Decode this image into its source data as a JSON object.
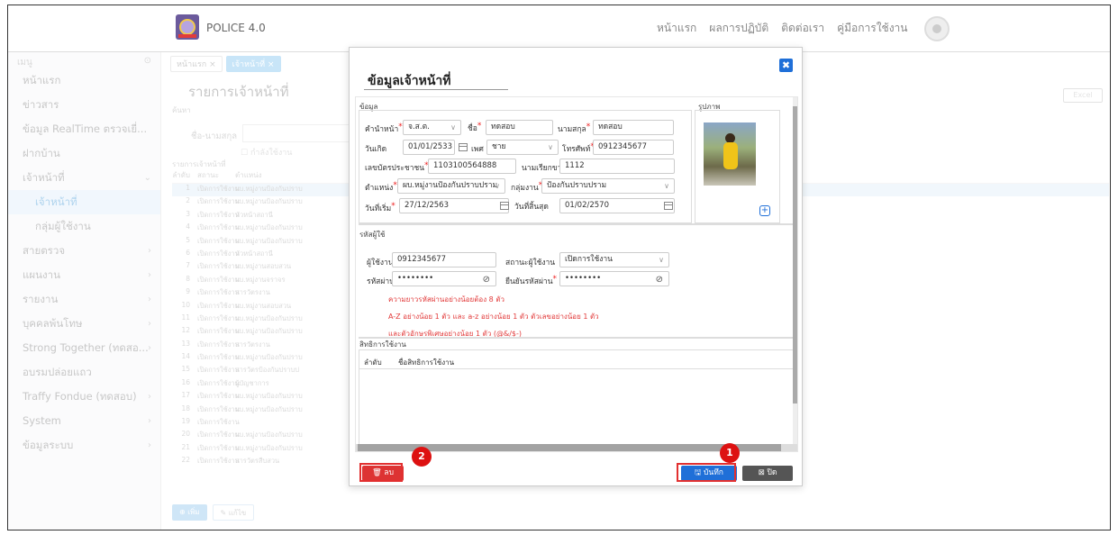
{
  "app": {
    "title": "POLICE 4.0",
    "logo_text": "POLICE 4.0"
  },
  "topnav": [
    "หน้าแรก",
    "ผลการปฏิบัติ",
    "ติดต่อเรา",
    "คู่มือการใช้งาน"
  ],
  "sidebar": {
    "header": "เมนู",
    "items": [
      {
        "label": "หน้าแรก",
        "arrow": ""
      },
      {
        "label": "ข่าวสาร",
        "arrow": ""
      },
      {
        "label": "ข้อมูล RealTime ตรวจเยี่...",
        "arrow": ""
      },
      {
        "label": "ฝากบ้าน",
        "arrow": ""
      },
      {
        "label": "เจ้าหน้าที่",
        "arrow": "⌄"
      },
      {
        "label": "เจ้าหน้าที่",
        "arrow": "",
        "sub": true,
        "active": true
      },
      {
        "label": "กลุ่มผู้ใช้งาน",
        "arrow": "",
        "sub": true
      },
      {
        "label": "สายตรวจ",
        "arrow": "›"
      },
      {
        "label": "แผนงาน",
        "arrow": "›"
      },
      {
        "label": "รายงาน",
        "arrow": "›"
      },
      {
        "label": "บุคคลพ้นโทษ",
        "arrow": "›"
      },
      {
        "label": "Strong Together (ทดสอ...",
        "arrow": "›"
      },
      {
        "label": "อบรมปล่อยแถว",
        "arrow": ""
      },
      {
        "label": "Traffy Fondue (ทดสอบ)",
        "arrow": "›"
      },
      {
        "label": "System",
        "arrow": "›"
      },
      {
        "label": "ข้อมูลระบบ",
        "arrow": "›"
      }
    ]
  },
  "main": {
    "tabs": [
      "หน้าแรก ×",
      "เจ้าหน้าที่ ×"
    ],
    "title": "รายการเจ้าหน้าที่",
    "search_label": "ค้นหา",
    "name_label": "ชื่อ-นามสกุล",
    "checkbox_label": "กำลังใช้งาน",
    "list_label": "รายการเจ้าหน้าที่",
    "excel": "Excel",
    "grid_headers": [
      "ลำดับ",
      "สถานะ",
      "ตำแหน่ง"
    ],
    "grid_rows": [
      [
        "1",
        "เปิดการใช้งาน",
        "ผบ.หมู่งานป้องกันปราบ"
      ],
      [
        "2",
        "เปิดการใช้งาน",
        "ผบ.หมู่งานป้องกันปราบ"
      ],
      [
        "3",
        "เปิดการใช้งาน",
        "หัวหน้าสถานี"
      ],
      [
        "4",
        "เปิดการใช้งาน",
        "ผบ.หมู่งานป้องกันปราบ"
      ],
      [
        "5",
        "เปิดการใช้งาน",
        "ผบ.หมู่งานป้องกันปราบ"
      ],
      [
        "6",
        "เปิดการใช้งาน",
        "หัวหน้าสถานี"
      ],
      [
        "7",
        "เปิดการใช้งาน",
        "ผบ.หมู่งานสอบสวน"
      ],
      [
        "8",
        "เปิดการใช้งาน",
        "ผบ.หมู่งานจราจร"
      ],
      [
        "9",
        "เปิดการใช้งาน",
        "สารวัตรงาน"
      ],
      [
        "10",
        "เปิดการใช้งาน",
        "ผบ.หมู่งานสอบสวน"
      ],
      [
        "11",
        "เปิดการใช้งาน",
        "ผบ.หมู่งานป้องกันปราบ"
      ],
      [
        "12",
        "เปิดการใช้งาน",
        "ผบ.หมู่งานป้องกันปราบ"
      ],
      [
        "13",
        "เปิดการใช้งาน",
        "สารวัตรงาน"
      ],
      [
        "14",
        "เปิดการใช้งาน",
        "ผบ.หมู่งานป้องกันปราบ"
      ],
      [
        "15",
        "เปิดการใช้งาน",
        "สารวัตรป้องกันปราบป"
      ],
      [
        "16",
        "เปิดการใช้งาน",
        "ผู้บัญชาการ"
      ],
      [
        "17",
        "เปิดการใช้งาน",
        "ผบ.หมู่งานป้องกันปราบ"
      ],
      [
        "18",
        "เปิดการใช้งาน",
        "ผบ.หมู่งานป้องกันปราบ"
      ],
      [
        "19",
        "เปิดการใช้งาน",
        ""
      ],
      [
        "20",
        "เปิดการใช้งาน",
        "ผบ.หมู่งานป้องกันปราบ"
      ],
      [
        "21",
        "เปิดการใช้งาน",
        "ผบ.หมู่งานป้องกันปราบ"
      ],
      [
        "22",
        "เปิดการใช้งาน",
        "สารวัตรสืบสวน"
      ]
    ],
    "add_label": "⊕ เพิ่ม",
    "edit_label": "✎ แก้ไข"
  },
  "modal": {
    "title": "ข้อมูลเจ้าหน้าที่",
    "close": "✖",
    "section_info": "ข้อมูล",
    "section_photo": "รูปภาพ",
    "fields": {
      "prefix_label": "คำนำหน้า",
      "prefix": "จ.ส.ต.",
      "first_label": "ชื่อ",
      "first": "ทดสอบ",
      "last_label": "นามสกุล",
      "last": "ทดสอบ",
      "dob_label": "วันเกิด",
      "dob": "01/01/2533",
      "sex_label": "เพศ",
      "sex": "ชาย",
      "phone_label": "โทรศัพท์",
      "phone": "0912345677",
      "idcard_label": "เลขบัตรประชาชน",
      "idcard": "1103100564888",
      "callsign_label": "นามเรียกขาน",
      "callsign": "1112",
      "position_label": "ตำแหน่ง",
      "position": "ผบ.หมู่งานป้องกันปราบปราม",
      "group_label": "กลุ่มงาน",
      "group": "ป้องกันปราบปราม",
      "start_label": "วันที่เริ่ม",
      "start": "27/12/2563",
      "end_label": "วันที่สิ้นสุด",
      "end": "01/02/2570"
    },
    "section_password": "รหัสผู้ใช้",
    "account": {
      "user_label": "ผู้ใช้งาน",
      "user": "0912345677",
      "status_label": "สถานะผู้ใช้งาน",
      "status": "เปิดการใช้งาน",
      "pass_label": "รหัสผ่าน",
      "pass": "••••••••",
      "confirm_label": "ยืนยันรหัสผ่าน",
      "confirm": "••••••••"
    },
    "warnings": [
      "ความยาวรหัสผ่านอย่างน้อยต้อง 8 ตัว",
      "A-Z อย่างน้อย 1 ตัว และ a-z อย่างน้อย 1 ตัว ตัวเลขอย่างน้อย 1 ตัว",
      "และตัวอักษรพิเศษอย่างน้อย 1 ตัว (@&/$-)"
    ],
    "section_rights": "สิทธิการใช้งาน",
    "rights_headers": [
      "ลำดับ",
      "ชื่อสิทธิการใช้งาน"
    ],
    "delete_label": "🗑 ลบ",
    "save_label": "🖫 บันทึก",
    "close_label": "⊠ ปิด"
  },
  "markers": [
    "1",
    "2"
  ],
  "colors": {
    "primary": "#1f6fd8",
    "danger": "#d33333",
    "highlight": "#e23030"
  }
}
